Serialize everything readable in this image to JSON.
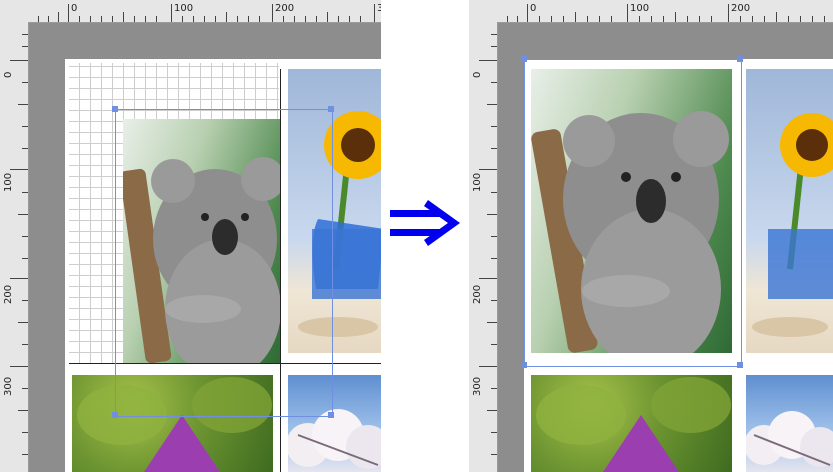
{
  "left_panel": {
    "ruler_h": {
      "labels": [
        "0",
        "100",
        "200",
        "3"
      ]
    },
    "ruler_v": {
      "labels": [
        "0",
        "100",
        "200",
        "300"
      ]
    }
  },
  "right_panel": {
    "ruler_h": {
      "labels": [
        "0",
        "100",
        "200"
      ]
    },
    "ruler_v": {
      "labels": [
        "0",
        "100",
        "200",
        "300"
      ]
    }
  },
  "transition_arrow": {
    "icon": "double-right-arrow-icon",
    "color": "#0000ee"
  },
  "colors": {
    "selection": "#6f8fe0",
    "canvas": "#8d8d8d",
    "ruler": "#e6e6e6"
  },
  "images": [
    "koala",
    "sunflower",
    "leaf-flower",
    "cherry-blossom"
  ]
}
